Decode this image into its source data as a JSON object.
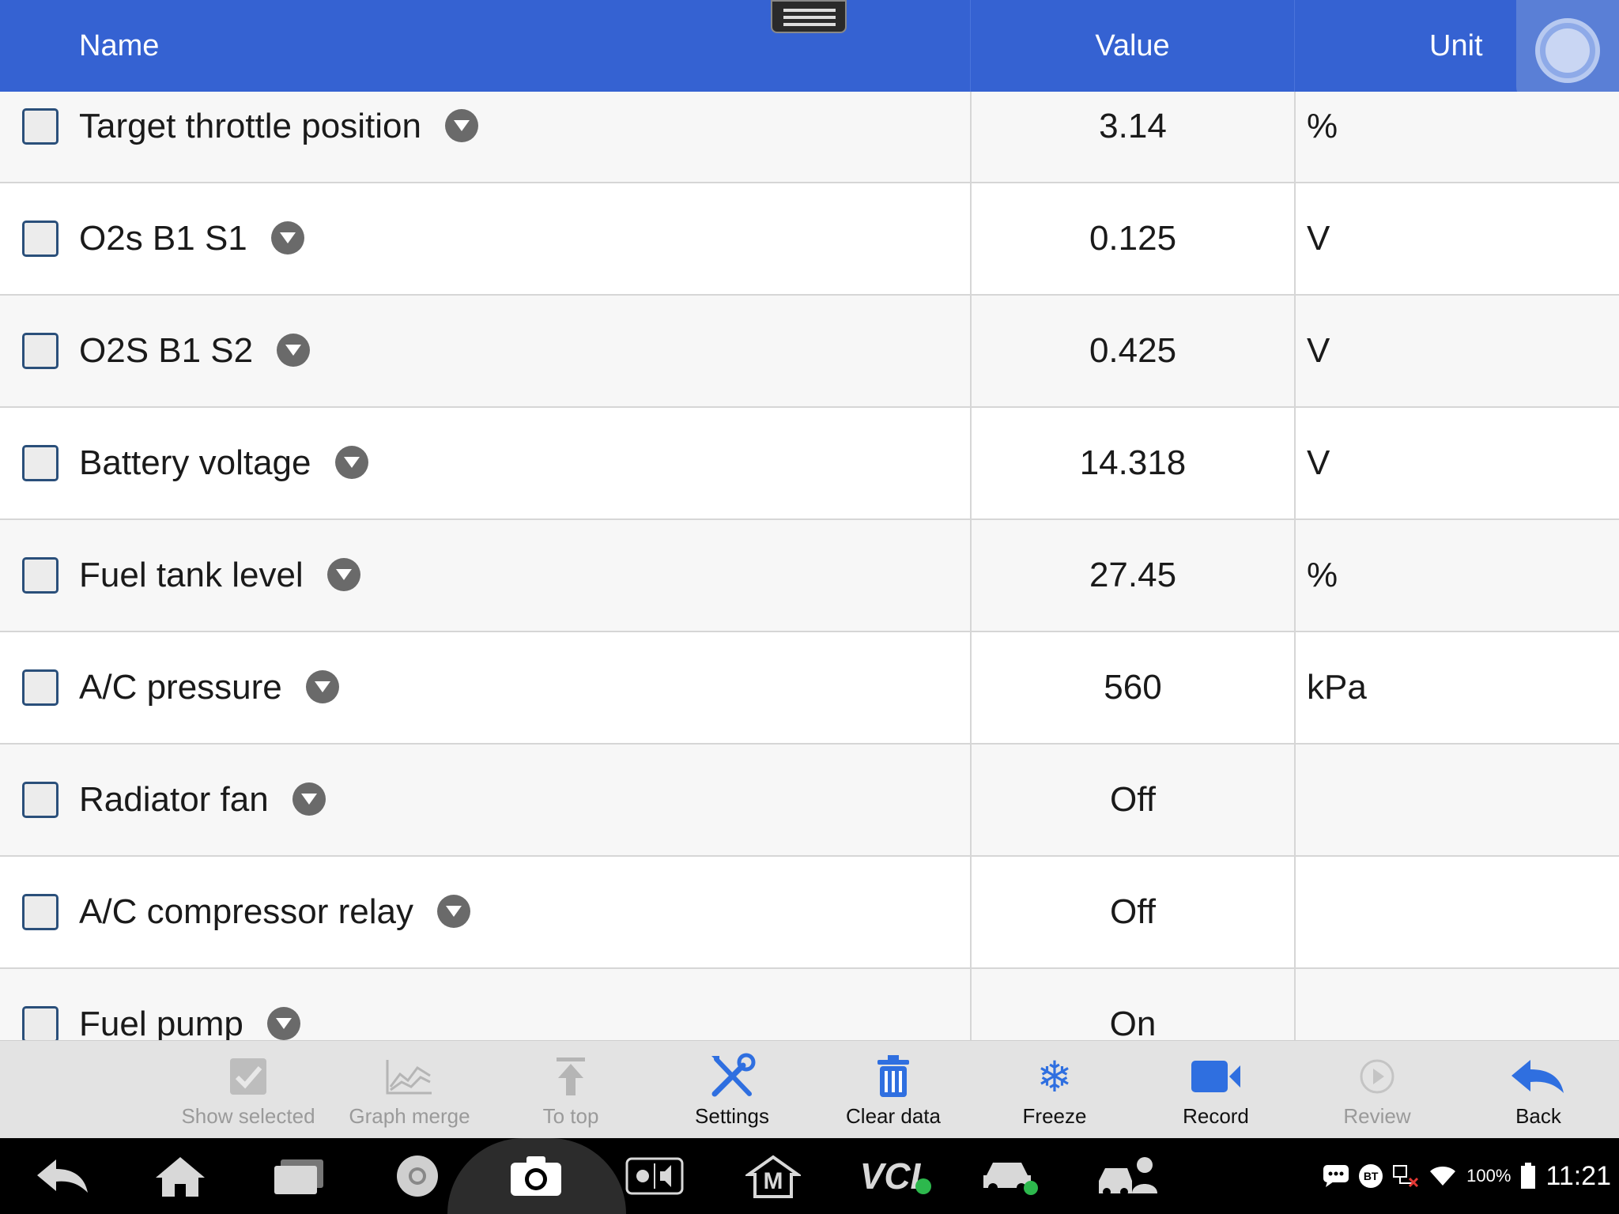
{
  "header": {
    "name_label": "Name",
    "value_label": "Value",
    "unit_label": "Unit"
  },
  "rows": [
    {
      "name": "Target throttle position",
      "value": "3.14",
      "unit": "%",
      "checked": false
    },
    {
      "name": "O2s B1 S1",
      "value": "0.125",
      "unit": "V",
      "checked": false
    },
    {
      "name": "O2S B1 S2",
      "value": "0.425",
      "unit": "V",
      "checked": false
    },
    {
      "name": "Battery voltage",
      "value": "14.318",
      "unit": "V",
      "checked": false
    },
    {
      "name": "Fuel tank level",
      "value": "27.45",
      "unit": "%",
      "checked": false
    },
    {
      "name": "A/C pressure",
      "value": "560",
      "unit": "kPa",
      "checked": false
    },
    {
      "name": "Radiator fan",
      "value": "Off",
      "unit": "",
      "checked": false
    },
    {
      "name": "A/C compressor relay",
      "value": "Off",
      "unit": "",
      "checked": false
    },
    {
      "name": "Fuel pump",
      "value": "On",
      "unit": "",
      "checked": false
    }
  ],
  "toolbar": [
    {
      "label": "Show selected",
      "icon": "check-box-icon",
      "enabled": false
    },
    {
      "label": "Graph merge",
      "icon": "graph-icon",
      "enabled": false
    },
    {
      "label": "To top",
      "icon": "arrow-up-icon",
      "enabled": false
    },
    {
      "label": "Settings",
      "icon": "tools-icon",
      "enabled": true
    },
    {
      "label": "Clear data",
      "icon": "trash-icon",
      "enabled": true
    },
    {
      "label": "Freeze",
      "icon": "snowflake-icon",
      "enabled": true
    },
    {
      "label": "Record",
      "icon": "video-camera-icon",
      "enabled": true
    },
    {
      "label": "Review",
      "icon": "play-circle-icon",
      "enabled": false
    },
    {
      "label": "Back",
      "icon": "back-arrow-icon",
      "enabled": true
    }
  ],
  "system_bar": {
    "battery": "100%",
    "time": "11:21",
    "vci_label": "VCI",
    "bt_label": "BT",
    "m_label": "M"
  },
  "colors": {
    "header_bg": "#3562d2",
    "accent_icon": "#2f6fe0",
    "toolbar_bg": "#e3e3e3",
    "status_ok": "#2db84d"
  }
}
